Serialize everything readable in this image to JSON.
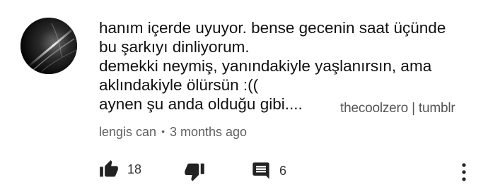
{
  "comment": {
    "lines": [
      "hanım içerde uyuyor. bense gecenin saat üçünde",
      "bu şarkıyı dinliyorum.",
      "demekki neymiş, yanındakiyle yaşlanırsın, ama",
      "aklındakiyle ölürsün :((",
      "aynen şu anda olduğu gibi...."
    ],
    "watermark": "thecoolzero | tumblr",
    "author": "lengis can",
    "separator": "•",
    "time": "3 months ago"
  },
  "actions": {
    "likes": "18",
    "replies": "6"
  },
  "icons": {
    "like": "thumb-up-icon",
    "dislike": "thumb-down-icon",
    "reply": "comment-icon",
    "more": "more-vertical-icon"
  },
  "colors": {
    "text": "#111111",
    "meta": "#606060",
    "icon": "#222222",
    "background": "#ffffff"
  }
}
